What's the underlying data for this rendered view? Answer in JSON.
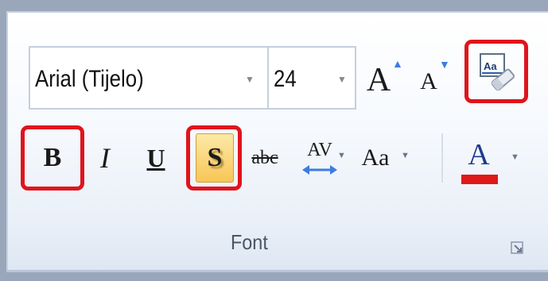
{
  "group": {
    "label": "Font"
  },
  "font_name": {
    "value": "Arial (Tijelo)"
  },
  "font_size": {
    "value": "24"
  },
  "buttons": {
    "grow_font": "A",
    "shrink_font": "A",
    "bold": "B",
    "italic": "I",
    "underline": "U",
    "shadow": "S",
    "strikethrough": "abc",
    "char_spacing": "AV",
    "change_case": "Aa",
    "font_color": "A"
  },
  "colors": {
    "highlight_ring": "#e0141c",
    "active_button": "#fbd46a",
    "font_color_bar": "#e01818",
    "spacing_arrow": "#3b7de0"
  }
}
